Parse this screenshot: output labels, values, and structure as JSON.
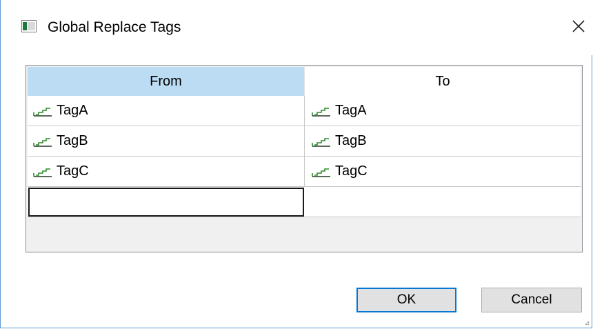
{
  "window": {
    "title": "Global Replace Tags",
    "close_icon": "close-icon"
  },
  "grid": {
    "columns": [
      "From",
      "To"
    ],
    "rows": [
      {
        "from": "TagA",
        "to": "TagA"
      },
      {
        "from": "TagB",
        "to": "TagB"
      },
      {
        "from": "TagC",
        "to": "TagC"
      }
    ],
    "new_row": {
      "from": "",
      "to": ""
    }
  },
  "buttons": {
    "ok": "OK",
    "cancel": "Cancel"
  },
  "colors": {
    "header_selected": "#bcdcf4",
    "accent": "#0078d7",
    "tag_icon": "#2e8b2e"
  }
}
